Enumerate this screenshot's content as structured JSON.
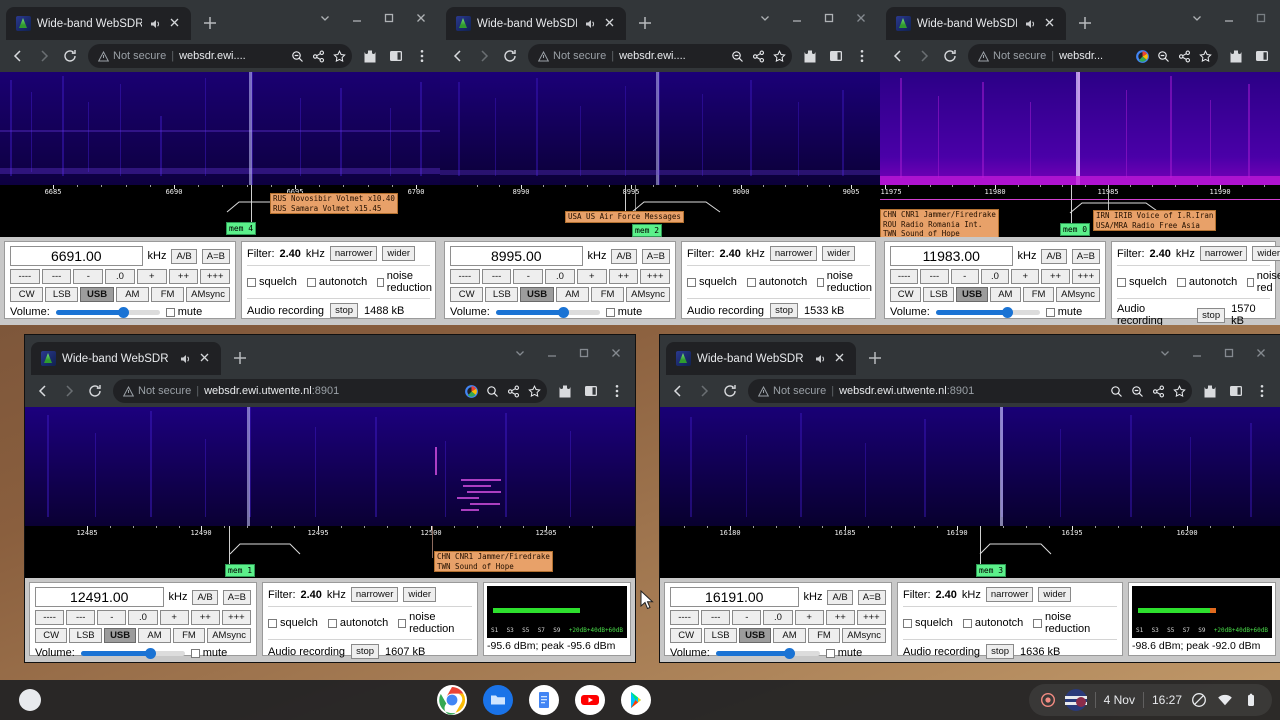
{
  "desktop": {
    "shelf": {
      "launcher_label": "launcher",
      "apps": [
        "chrome",
        "files",
        "docs",
        "youtube",
        "play-store"
      ],
      "tray": {
        "record_label": "recording",
        "date": "4 Nov",
        "time": "16:27",
        "status_icons": [
          "do-not-disturb",
          "wifi",
          "battery"
        ]
      }
    }
  },
  "windows": [
    {
      "id": "win1",
      "tab_title": "Wide-band WebSDR in Ensch",
      "url_display": "websdr.ewi....",
      "url_scheme_note": "Not secure",
      "scale": {
        "ticks": [
          6685,
          6690,
          6695,
          6700
        ],
        "start": 6683.5,
        "end": 6701.5
      },
      "mem_tag": "mem 4",
      "stations": [
        "RUS Novosibir Volmet x10.40",
        "RUS Samara Volmet x15.45"
      ],
      "panel": {
        "frequency": "6691.00",
        "unit": "kHz",
        "ab_label": "A/B",
        "aeqb_label": "A=B",
        "steps": [
          "----",
          "---",
          "-",
          ".0",
          "+",
          "++",
          "+++"
        ],
        "modes": [
          "CW",
          "LSB",
          "USB",
          "AM",
          "FM",
          "AMsync"
        ],
        "mode_selected": "USB",
        "volume_label": "Volume:",
        "volume_pct": 66,
        "mute_label": "mute",
        "filter_label": "Filter:",
        "filter_value": "2.40",
        "filter_unit": "kHz",
        "narrower_label": "narrower",
        "wider_label": "wider",
        "squelch_label": "squelch",
        "autonotch_label": "autonotch",
        "noise_reduction_label": "noise reduction",
        "recording_label": "Audio recording",
        "stop_label": "stop",
        "recording_size": "1488 kB"
      }
    },
    {
      "id": "win2",
      "tab_title": "Wide-band WebSDR in Ensch",
      "url_display": "websdr.ewi....",
      "url_scheme_note": "Not secure",
      "scale": {
        "ticks": [
          8990,
          8995,
          9000,
          9005
        ],
        "start": 8986.5,
        "end": 9006.5
      },
      "mem_tag": "mem 2",
      "stations": [
        "USA US Air Force Messages"
      ],
      "panel": {
        "frequency": "8995.00",
        "unit": "kHz",
        "ab_label": "A/B",
        "aeqb_label": "A=B",
        "steps": [
          "----",
          "---",
          "-",
          ".0",
          "+",
          "++",
          "+++"
        ],
        "modes": [
          "CW",
          "LSB",
          "USB",
          "AM",
          "FM",
          "AMsync"
        ],
        "mode_selected": "USB",
        "volume_label": "Volume:",
        "volume_pct": 66,
        "mute_label": "mute",
        "filter_label": "Filter:",
        "filter_value": "2.40",
        "filter_unit": "kHz",
        "narrower_label": "narrower",
        "wider_label": "wider",
        "squelch_label": "squelch",
        "autonotch_label": "autonotch",
        "noise_reduction_label": "noise reduction",
        "recording_label": "Audio recording",
        "stop_label": "stop",
        "recording_size": "1533 kB"
      }
    },
    {
      "id": "win3",
      "tab_title": "Wide-band WebSDR in Ensch",
      "url_display": "websdr...",
      "url_scheme_note": "Not secure",
      "scale": {
        "ticks": [
          11975,
          11980,
          11985,
          11990
        ],
        "start": 11974.5,
        "end": 11992.0
      },
      "mem_tag": "mem 0",
      "stations_left": [
        "CHN CNR1 Jammer/Firedrake",
        "ROU Radio Romania Int.",
        "TWN Sound of Hope"
      ],
      "stations_right": [
        "IRN IRIB Voice of I.R.Iran",
        "USA/MRA Radio Free Asia"
      ],
      "panel": {
        "frequency": "11983.00",
        "unit": "kHz",
        "ab_label": "A/B",
        "aeqb_label": "A=B",
        "steps": [
          "----",
          "---",
          "-",
          ".0",
          "+",
          "++",
          "+++"
        ],
        "modes": [
          "CW",
          "LSB",
          "USB",
          "AM",
          "FM",
          "AMsync"
        ],
        "mode_selected": "USB",
        "volume_label": "Volume:",
        "volume_pct": 70,
        "mute_label": "mute",
        "filter_label": "Filter:",
        "filter_value": "2.40",
        "filter_unit": "kHz",
        "narrower_label": "narrower",
        "wider_label": "wider",
        "squelch_label": "squelch",
        "autonotch_label": "autonotch",
        "noise_reduction_label": "noise red",
        "recording_label": "Audio recording",
        "stop_label": "stop",
        "recording_size": "1570 kB"
      }
    },
    {
      "id": "win4",
      "tab_title": "Wide-band WebSDR in Ensc",
      "url_display": "websdr.ewi.utwente.nl",
      "url_port": ":8901",
      "url_scheme_note": "Not secure",
      "scale": {
        "ticks": [
          12485,
          12490,
          12495,
          12500,
          12505
        ],
        "start": 12482.0,
        "end": 12507.5
      },
      "mem_tag": "mem 1",
      "stations": [
        "CHN CNR1 Jammer/Firedrake",
        "TWN Sound of Hope"
      ],
      "panel": {
        "frequency": "12491.00",
        "unit": "kHz",
        "ab_label": "A/B",
        "aeqb_label": "A=B",
        "steps": [
          "----",
          "---",
          "-",
          ".0",
          "+",
          "++",
          "+++"
        ],
        "modes": [
          "CW",
          "LSB",
          "USB",
          "AM",
          "FM",
          "AMsync"
        ],
        "mode_selected": "USB",
        "volume_label": "Volume:",
        "volume_pct": 68,
        "mute_label": "mute",
        "filter_label": "Filter:",
        "filter_value": "2.40",
        "filter_unit": "kHz",
        "narrower_label": "narrower",
        "wider_label": "wider",
        "squelch_label": "squelch",
        "autonotch_label": "autonotch",
        "noise_reduction_label": "noise reduction",
        "recording_label": "Audio recording",
        "stop_label": "stop",
        "recording_size": "1607 kB",
        "smeter_text": "-95.6 dBm; peak  -95.6 dBm",
        "smeter_scale": [
          "S1",
          "S3",
          "S5",
          "S7",
          "S9",
          "+20dB",
          "+40dB",
          "+60dB"
        ],
        "smeter_level_pct": 68,
        "smeter_peak": false
      }
    },
    {
      "id": "win5",
      "tab_title": "Wide-band WebSDR in Ensc",
      "url_display": "websdr.ewi.utwente.nl",
      "url_port": ":8901",
      "url_scheme_note": "Not secure",
      "scale": {
        "ticks": [
          16180,
          16185,
          16190,
          16195,
          16200
        ],
        "start": 16177.0,
        "end": 16202.5
      },
      "mem_tag": "mem 3",
      "stations": [],
      "panel": {
        "frequency": "16191.00",
        "unit": "kHz",
        "ab_label": "A/B",
        "aeqb_label": "A=B",
        "steps": [
          "----",
          "---",
          "-",
          ".0",
          "+",
          "++",
          "+++"
        ],
        "modes": [
          "CW",
          "LSB",
          "USB",
          "AM",
          "FM",
          "AMsync"
        ],
        "mode_selected": "USB",
        "volume_label": "Volume:",
        "volume_pct": 72,
        "mute_label": "mute",
        "filter_label": "Filter:",
        "filter_value": "2.40",
        "filter_unit": "kHz",
        "narrower_label": "narrower",
        "wider_label": "wider",
        "squelch_label": "squelch",
        "autonotch_label": "autonotch",
        "noise_reduction_label": "noise reduction",
        "recording_label": "Audio recording",
        "stop_label": "stop",
        "recording_size": "1636 kB",
        "smeter_text": "-98.6 dBm; peak  -92.0 dBm",
        "smeter_scale": [
          "S1",
          "S3",
          "S5",
          "S7",
          "S9",
          "+20dB",
          "+40dB",
          "+60dB"
        ],
        "smeter_level_pct": 62,
        "smeter_peak": true
      }
    }
  ],
  "colors": {
    "chrome_toolbar": "#323639",
    "chrome_tabstrip": "#323639",
    "waterfall_blue": "#12005e",
    "mem_tag_green": "#5bf08a",
    "station_tag_orange": "#e8a169",
    "slider_blue": "#1a73d4",
    "smeter_green": "#2ee02e",
    "smeter_peak_orange": "#e06a1e"
  }
}
